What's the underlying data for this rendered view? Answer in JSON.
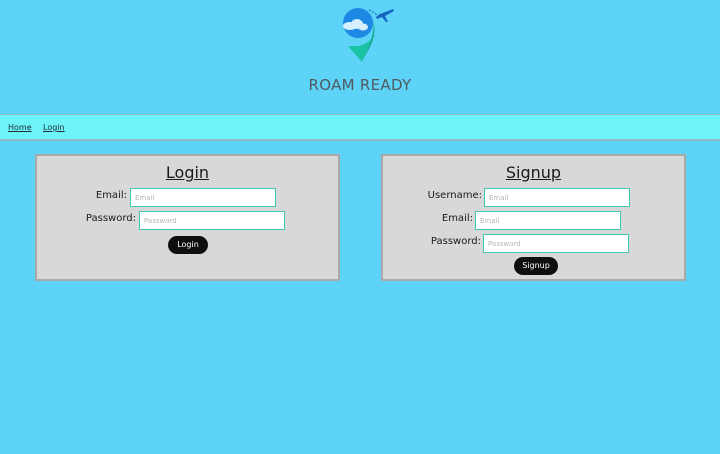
{
  "brand": {
    "title": "ROAM READY",
    "logo_icon": "location-pin-airplane-icon",
    "colors": {
      "pin_blue": "#1e88e5",
      "pin_teal": "#19c3a3",
      "plane": "#1565c0"
    }
  },
  "nav": {
    "items": [
      {
        "label": "Home"
      },
      {
        "label": "Login"
      }
    ]
  },
  "login": {
    "title": "Login",
    "email_label": "Email:",
    "email_placeholder": "Email",
    "password_label": "Password:",
    "password_placeholder": "Password",
    "button_label": "Login"
  },
  "signup": {
    "title": "Signup",
    "username_label": "Username:",
    "username_placeholder": "Email",
    "email_label": "Email:",
    "email_placeholder": "Email",
    "password_label": "Password:",
    "password_placeholder": "Password",
    "button_label": "Signup"
  },
  "colors": {
    "page_background": "#5dd3f8",
    "navbar_background": "#6df3f8",
    "panel_background": "#d8d8d8",
    "input_border": "#3fc9b0",
    "button_background": "#0f0f0f"
  }
}
